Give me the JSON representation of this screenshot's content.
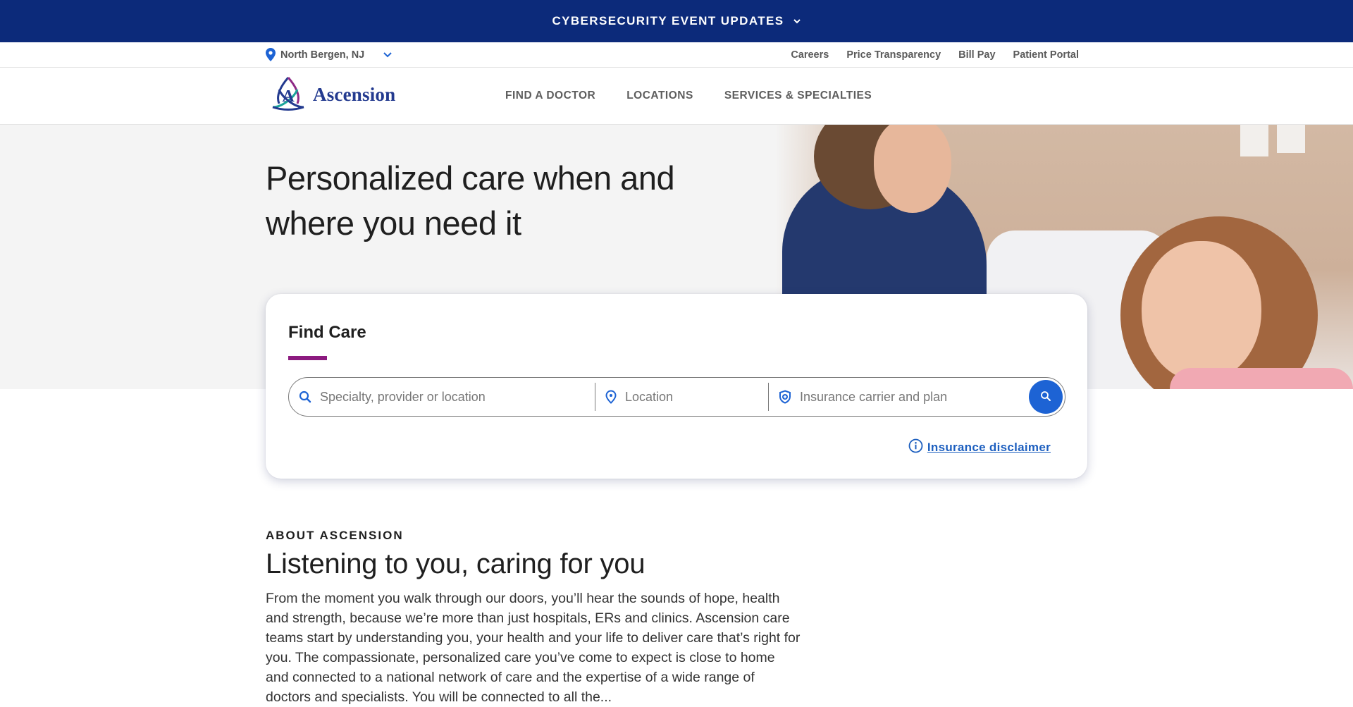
{
  "alert_bar": {
    "label": "CYBERSECURITY EVENT UPDATES",
    "icon": "chevron-down-icon",
    "bg_color": "#0c2a7a"
  },
  "utility_bar": {
    "location": {
      "label": "North Bergen, NJ",
      "icon": "map-pin-icon",
      "dropdown_icon": "chevron-down-icon"
    },
    "links": [
      {
        "label": "Careers"
      },
      {
        "label": "Price Transparency"
      },
      {
        "label": "Bill Pay"
      },
      {
        "label": "Patient Portal"
      }
    ]
  },
  "main_nav": {
    "logo_text": "Ascension",
    "brand_color": "#233a8f",
    "links": [
      {
        "label": "FIND A DOCTOR"
      },
      {
        "label": "LOCATIONS"
      },
      {
        "label": "SERVICES & SPECIALTIES"
      }
    ]
  },
  "hero": {
    "title": "Personalized care when and where you need it",
    "image_alt": "Nurse smiling at young girl in hospital bed"
  },
  "find_care": {
    "title": "Find Care",
    "accent_color": "#8c1a7f",
    "fields": [
      {
        "icon": "search-icon",
        "placeholder": "Specialty, provider or location",
        "value": ""
      },
      {
        "icon": "map-pin-icon",
        "placeholder": "Location",
        "value": ""
      },
      {
        "icon": "shield-plus-icon",
        "placeholder": "Insurance carrier and plan",
        "value": ""
      }
    ],
    "search_button_icon": "search-icon",
    "search_button_color": "#1d63d4",
    "disclaimer": {
      "icon": "info-icon",
      "label": "Insurance disclaimer"
    }
  },
  "about": {
    "eyebrow": "ABOUT ASCENSION",
    "title": "Listening to you, caring for you",
    "body": "From the moment you walk through our doors, you’ll hear the sounds of hope, health and strength, because we’re more than just hospitals, ERs and clinics. Ascension care teams start by understanding you, your health and your life to deliver care that’s right for you. The compassionate, personalized care you’ve come to expect is close to home and connected to a national network of care and the expertise of a wide range of doctors and specialists. You will be connected to all the..."
  }
}
